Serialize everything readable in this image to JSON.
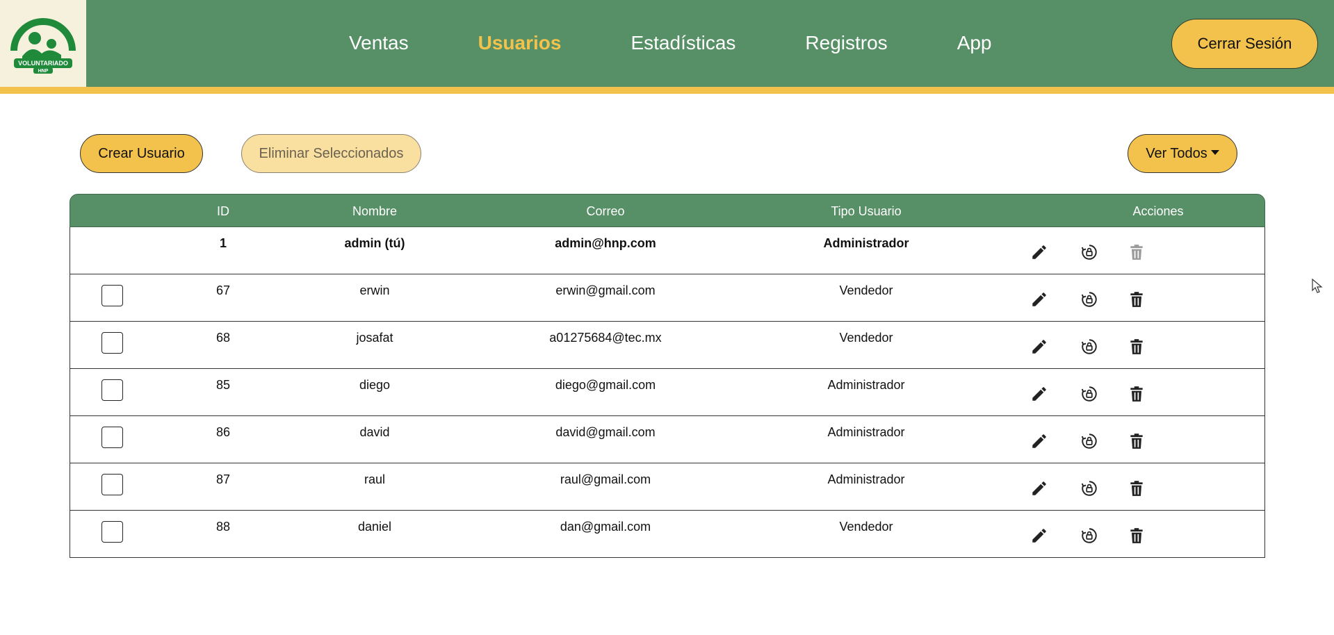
{
  "header": {
    "logo_text": "VOLUNTARIADO HNP",
    "nav": [
      {
        "label": "Ventas",
        "active": false
      },
      {
        "label": "Usuarios",
        "active": true
      },
      {
        "label": "Estadísticas",
        "active": false
      },
      {
        "label": "Registros",
        "active": false
      },
      {
        "label": "App",
        "active": false
      }
    ],
    "logout_label": "Cerrar Sesión"
  },
  "toolbar": {
    "create_label": "Crear Usuario",
    "delete_selected_label": "Eliminar Seleccionados",
    "filter_label": "Ver Todos"
  },
  "table": {
    "headers": {
      "id": "ID",
      "name": "Nombre",
      "email": "Correo",
      "type": "Tipo Usuario",
      "actions": "Acciones"
    },
    "rows": [
      {
        "id": "1",
        "name": "admin (tú)",
        "email": "admin@hnp.com",
        "type": "Administrador",
        "self": true
      },
      {
        "id": "67",
        "name": "erwin",
        "email": "erwin@gmail.com",
        "type": "Vendedor",
        "self": false
      },
      {
        "id": "68",
        "name": "josafat",
        "email": "a01275684@tec.mx",
        "type": "Vendedor",
        "self": false
      },
      {
        "id": "85",
        "name": "diego",
        "email": "diego@gmail.com",
        "type": "Administrador",
        "self": false
      },
      {
        "id": "86",
        "name": "david",
        "email": "david@gmail.com",
        "type": "Administrador",
        "self": false
      },
      {
        "id": "87",
        "name": "raul",
        "email": "raul@gmail.com",
        "type": "Administrador",
        "self": false
      },
      {
        "id": "88",
        "name": "daniel",
        "email": "dan@gmail.com",
        "type": "Vendedor",
        "self": false
      }
    ]
  },
  "colors": {
    "header_green": "#579066",
    "accent_yellow": "#f3c24c"
  },
  "icons": [
    "pencil-icon",
    "lock-reset-icon",
    "trash-icon"
  ]
}
